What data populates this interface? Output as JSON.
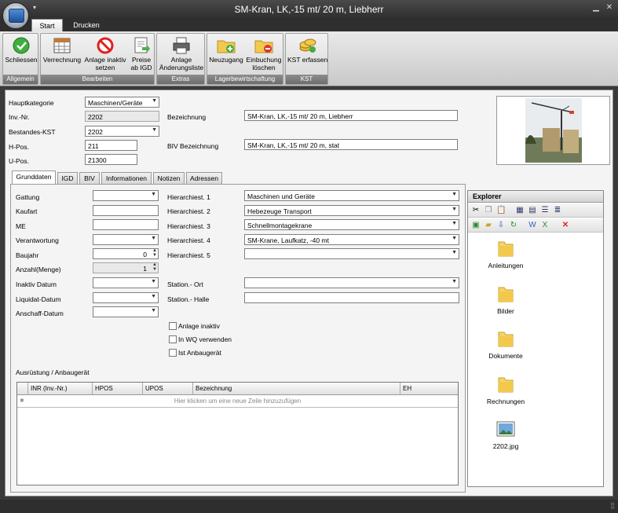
{
  "window": {
    "title": "SM-Kran, LK,-15 mt/ 20 m, Liebherr",
    "qa_glyph": "▾",
    "minimize": "▁",
    "close": "✕"
  },
  "ribbon_tabs": [
    {
      "label": "Start"
    },
    {
      "label": "Drucken"
    }
  ],
  "ribbon_groups": [
    {
      "caption": "Allgemein",
      "buttons": [
        {
          "label": "Schliessen",
          "icon": "check-circle-icon"
        }
      ]
    },
    {
      "caption": "Bearbeiten",
      "buttons": [
        {
          "label": "Verrechnung",
          "icon": "table-calc-icon"
        },
        {
          "label": "Anlage inaktiv setzen",
          "l1": "Anlage inaktiv",
          "l2": "setzen",
          "icon": "no-entry-icon"
        },
        {
          "label": "Preise ab IGD",
          "l1": "Preise",
          "l2": "ab IGD",
          "icon": "price-sheet-icon"
        }
      ]
    },
    {
      "caption": "Extras",
      "buttons": [
        {
          "label": "Anlage Änderungsliste",
          "l1": "Anlage",
          "l2": "Änderungsliste",
          "icon": "printer-icon"
        }
      ]
    },
    {
      "caption": "Lagerbewirtschaftung",
      "buttons": [
        {
          "label": "Neuzugang",
          "icon": "folder-add-icon"
        },
        {
          "label": "Einbuchung löschen",
          "l1": "Einbuchung",
          "l2": "löschen",
          "icon": "folder-delete-icon"
        }
      ]
    },
    {
      "caption": "KST",
      "buttons": [
        {
          "label": "KST erfassen",
          "icon": "coins-icon"
        }
      ]
    }
  ],
  "header": {
    "hauptkategorie_label": "Hauptkategorie",
    "hauptkategorie_value": "Maschinen/Geräte",
    "invnr_label": "Inv.-Nr.",
    "invnr_value": "2202",
    "bestandes_kst_label": "Bestandes-KST",
    "bestandes_kst_value": "2202",
    "hpos_label": "H-Pos.",
    "hpos_value": "211",
    "upos_label": "U-Pos.",
    "upos_value": "21300",
    "bezeichnung_label": "Bezeichnung",
    "bezeichnung_value": "SM-Kran, LK,-15 mt/ 20 m, Liebherr",
    "biv_bezeichnung_label": "BIV Bezeichnung",
    "biv_bezeichnung_value": "SM-Kran, LK,-15 mt/ 20 m, stat"
  },
  "form_tabs": [
    {
      "label": "Grunddaten",
      "active": true
    },
    {
      "label": "IGD"
    },
    {
      "label": "BIV"
    },
    {
      "label": "Informationen"
    },
    {
      "label": "Notizen"
    },
    {
      "label": "Adressen"
    }
  ],
  "grunddaten": {
    "gattung": "Gattung",
    "kaufart": "Kaufart",
    "me": "ME",
    "verantwortung": "Verantwortung",
    "baujahr": "Baujahr",
    "baujahr_value": "0",
    "anzahl": "Anzahl(Menge)",
    "anzahl_value": "1",
    "inaktiv_datum": "Inaktiv Datum",
    "liquidat_datum": "Liquidat-Datum",
    "anschaff_datum": "Anschaff-Datum",
    "hier1": "Hierarchiest. 1",
    "hier1_value": "Maschinen und Geräte",
    "hier2": "Hierarchiest. 2",
    "hier2_value": "Hebezeuge Transport",
    "hier3": "Hierarchiest. 3",
    "hier3_value": "Schnellmontagekrane",
    "hier4": "Hierarchiest. 4",
    "hier4_value": "SM-Krane, Laufkatz, -40 mt",
    "hier5": "Hierarchiest. 5",
    "station_ort": "Station.- Ort",
    "station_halle": "Station.- Halle",
    "cb_inaktiv": "Anlage inaktiv",
    "cb_wq": "In WQ verwenden",
    "cb_anbau": "Ist Anbaugerät"
  },
  "equipment": {
    "title": "Ausrüstung / Anbaugerät",
    "columns": [
      "INR (Inv.-Nr.)",
      "HPOS",
      "UPOS",
      "Bezeichnung",
      "EH"
    ],
    "new_row_hint": "Hier klicken um eine neue Zeile hinzuzufügen"
  },
  "explorer": {
    "title": "Explorer",
    "items": [
      {
        "label": "Anleitungen",
        "icon": "folder-icon"
      },
      {
        "label": "Bilder",
        "icon": "folder-icon"
      },
      {
        "label": "Dokumente",
        "icon": "folder-icon"
      },
      {
        "label": "Rechnungen",
        "icon": "folder-icon"
      },
      {
        "label": "2202.jpg",
        "icon": "image-file-icon"
      }
    ]
  },
  "colors": {
    "chrome": "#3a3a3a",
    "panel": "#f4f4f4",
    "accent": "#1d4f9a"
  }
}
